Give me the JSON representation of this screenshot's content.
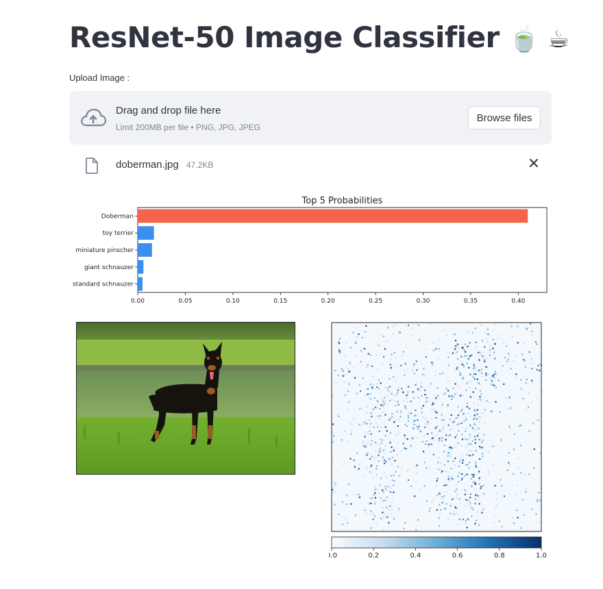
{
  "header": {
    "title": "ResNet-50 Image Classifier",
    "emoji": "🍵 ☕"
  },
  "uploader": {
    "label": "Upload Image :",
    "drop_text": "Drag and drop file here",
    "limit_text": "Limit 200MB per file • PNG, JPG, JPEG",
    "browse_label": "Browse files",
    "file_name": "doberman.jpg",
    "file_size": "47.2KB"
  },
  "chart_data": {
    "type": "bar",
    "orientation": "horizontal",
    "title": "Top 5 Probabilities",
    "categories": [
      "Doberman",
      "toy terrier",
      "miniature pinscher",
      "giant schnauzer",
      "standard schnauzer"
    ],
    "values": [
      0.41,
      0.017,
      0.015,
      0.006,
      0.005
    ],
    "colors": [
      "#f4634b",
      "#3a8ff0",
      "#3a8ff0",
      "#3a8ff0",
      "#3a8ff0"
    ],
    "xlim": [
      0.0,
      0.43
    ],
    "xticks": [
      "0.00",
      "0.05",
      "0.10",
      "0.15",
      "0.20",
      "0.25",
      "0.30",
      "0.35",
      "0.40"
    ],
    "xlabel": "",
    "ylabel": "",
    "grid": false
  },
  "saliency": {
    "colorbar_ticks": [
      "0.0",
      "0.2",
      "0.4",
      "0.6",
      "0.8",
      "1.0"
    ],
    "colormap": [
      "#f7fbff",
      "#c6dbef",
      "#6baed6",
      "#2171b5",
      "#08306b"
    ]
  }
}
